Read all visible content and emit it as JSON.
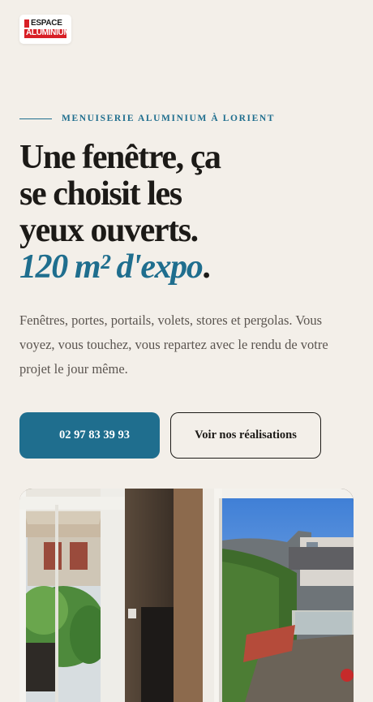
{
  "brand": {
    "logo_line1": "ESPACE",
    "logo_line2": "ALUMINIUM",
    "brand_color": "#d81f26"
  },
  "hero": {
    "eyebrow": "MENUISERIE ALUMINIUM À LORIENT",
    "headline_line1": "Une fenêtre, ça",
    "headline_line2": "se choisit les",
    "headline_line3": "yeux ouverts.",
    "headline_accent": "120 m² d'expo",
    "headline_end": ".",
    "description": "Fenêtres, portes, portails, volets, stores et pergolas. Vous voyez, vous touchez, vous repartez avec le rendu de votre projet le jour même.",
    "accent_color": "#1f6e8e"
  },
  "actions": {
    "call_label": "02 97 83 39 93",
    "call_icon": "phone-icon",
    "realisations_label": "Voir nos réalisations"
  }
}
